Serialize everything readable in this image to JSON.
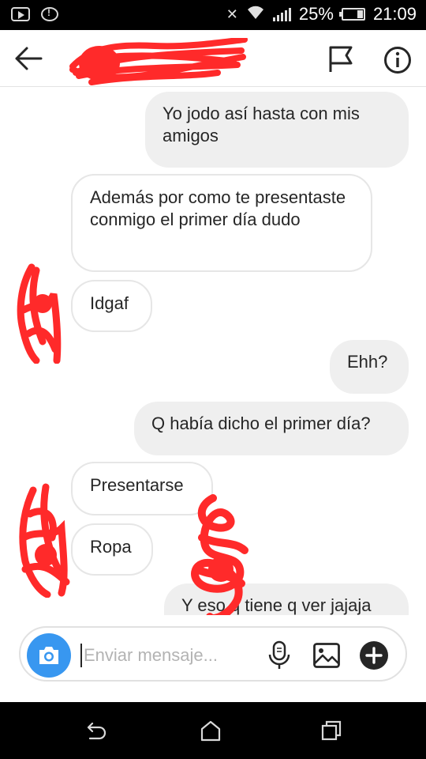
{
  "status_bar": {
    "battery": "25%",
    "time": "21:09"
  },
  "header": {
    "back_icon": "arrow-left-icon",
    "report_icon": "flag-icon",
    "info_icon": "info-icon"
  },
  "messages": [
    {
      "side": "outgoing",
      "text": "Yo jodo así hasta con mis amigos"
    },
    {
      "side": "incoming",
      "text": "Además por como te presentaste conmigo el primer día dudo"
    },
    {
      "side": "incoming",
      "text": "Idgaf"
    },
    {
      "side": "outgoing",
      "text": "Ehh?"
    },
    {
      "side": "outgoing",
      "text": "Q había dicho el primer día?"
    },
    {
      "side": "incoming",
      "text": "Presentarse"
    },
    {
      "side": "incoming",
      "text": "Ropa"
    },
    {
      "side": "outgoing",
      "text": "Y eso q tiene q ver jajaja"
    }
  ],
  "composer": {
    "placeholder": "Enviar mensaje..."
  },
  "colors": {
    "accent": "#3897f0",
    "outgoing_bubble": "#efefef",
    "incoming_border": "#e6e6e6",
    "redaction": "#ff2a2a"
  }
}
